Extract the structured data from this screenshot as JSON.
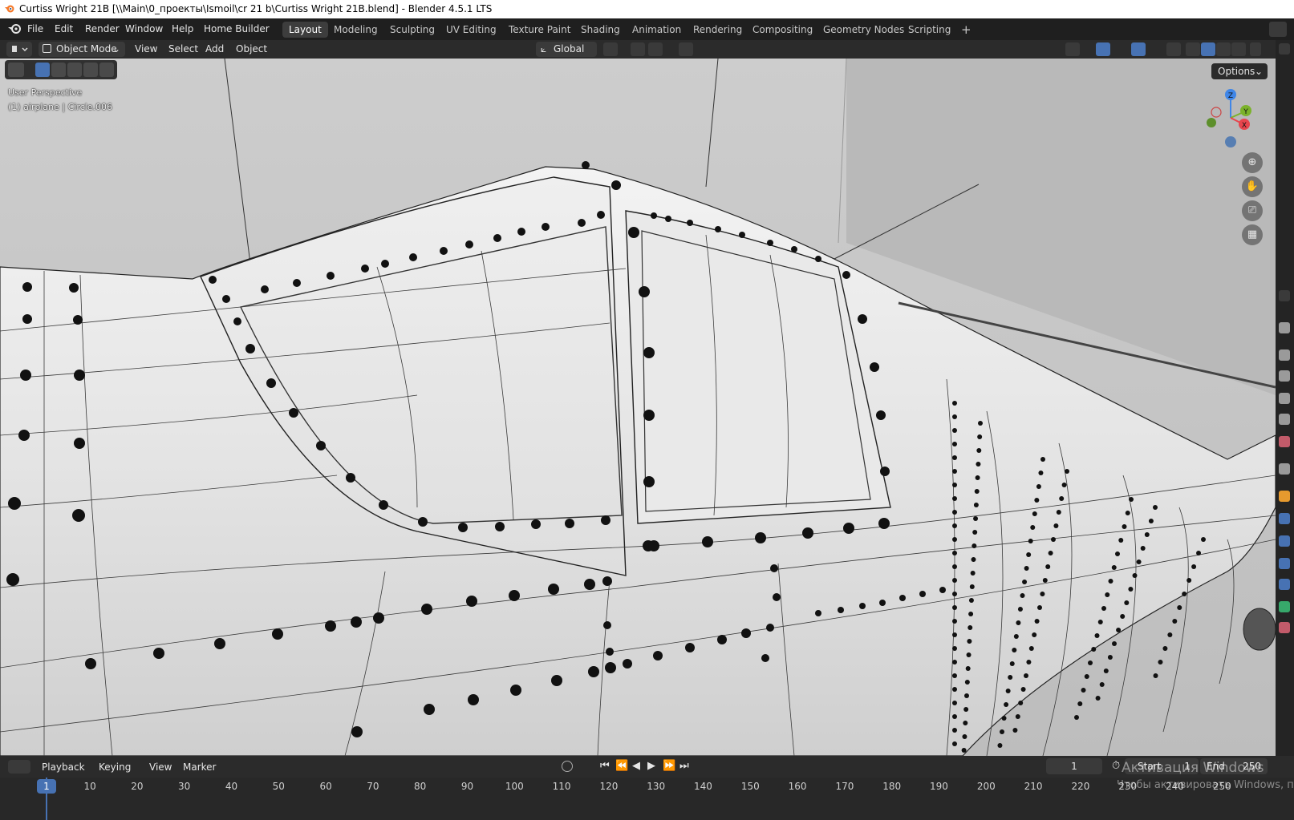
{
  "title_bar": {
    "text": "Curtiss Wright 21B [\\\\Main\\0_проекты\\Ismoil\\cr 21 b\\Curtiss Wright 21B.blend] - Blender 4.5.1 LTS"
  },
  "menu": [
    "File",
    "Edit",
    "Render",
    "Window",
    "Help",
    "Home Builder"
  ],
  "workspaces": {
    "active": "Layout",
    "tabs": [
      "Layout",
      "Modeling",
      "Sculpting",
      "UV Editing",
      "Texture Paint",
      "Shading",
      "Animation",
      "Rendering",
      "Compositing",
      "Geometry Nodes",
      "Scripting"
    ],
    "add": "+"
  },
  "viewport_header": {
    "mode": "Object Mode",
    "menus": [
      "View",
      "Select",
      "Add",
      "Object"
    ],
    "transform_orientation": "Global"
  },
  "viewport": {
    "perspective_label": "User Perspective",
    "object_label": "(1) airplane | Circle.006",
    "options_label": "Options",
    "gizmo_axes": [
      "Z",
      "Y",
      "X"
    ],
    "nav_icons": [
      "zoom-icon",
      "hand-pan-icon",
      "camera-view-icon",
      "grid-ortho-icon"
    ]
  },
  "timeline": {
    "menus": [
      "Playback",
      "Keying",
      "View",
      "Marker"
    ],
    "current_frame": "1",
    "start_label": "Start",
    "start_value": "1",
    "end_label": "End",
    "end_value": "250",
    "ruler": [
      "1",
      "10",
      "20",
      "30",
      "40",
      "50",
      "60",
      "70",
      "80",
      "90",
      "100",
      "110",
      "120",
      "130",
      "140",
      "150",
      "160",
      "170",
      "180",
      "190",
      "200",
      "210",
      "220",
      "230",
      "240",
      "250"
    ]
  },
  "watermark": {
    "line1": "Активация Windows",
    "line2": "Чтобы активировать Windows, п"
  },
  "colors": {
    "accent_blue": "#4772b3",
    "axis_x": "#e8454d",
    "axis_y": "#7bb22b",
    "axis_z": "#3f86e8",
    "viewport_bg": "#cfcfcf"
  }
}
